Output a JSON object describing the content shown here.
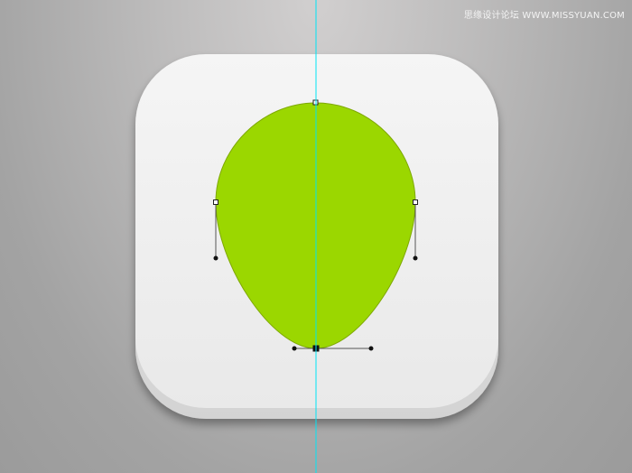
{
  "watermark": {
    "text": "思缘设计论坛  WWW.MISSYUAN.COM"
  },
  "colors": {
    "background": "#a9a9a9",
    "icon_base": "#ebebeb",
    "icon_shadow": "#d6d6d6",
    "shape_fill": "#9bd700",
    "guide_line": "#00e5f5",
    "path_handle": "#222222"
  },
  "icons": {
    "app_icon": "rounded-square-app-icon",
    "shape": "egg-shape",
    "guide": "vertical-guide-line"
  }
}
